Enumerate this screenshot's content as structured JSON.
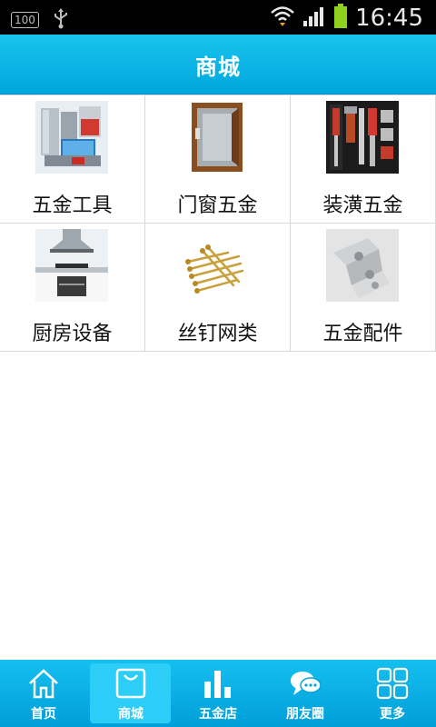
{
  "status_bar": {
    "badge": "100",
    "time": "16:45"
  },
  "header": {
    "title": "商城"
  },
  "categories": [
    {
      "label": "五金工具",
      "icon": "appliances-image"
    },
    {
      "label": "门窗五金",
      "icon": "window-image"
    },
    {
      "label": "装潢五金",
      "icon": "toolkit-image"
    },
    {
      "label": "厨房设备",
      "icon": "kitchen-image"
    },
    {
      "label": "丝钉网类",
      "icon": "nails-image"
    },
    {
      "label": "五金配件",
      "icon": "hinge-image"
    }
  ],
  "tabs": [
    {
      "label": "首页",
      "icon": "home-icon"
    },
    {
      "label": "商城",
      "icon": "shopping-bag-icon",
      "active": true
    },
    {
      "label": "五金店",
      "icon": "bar-chart-icon"
    },
    {
      "label": "朋友圈",
      "icon": "chat-icon"
    },
    {
      "label": "更多",
      "icon": "grid-icon"
    }
  ],
  "colors": {
    "accent": "#00a6dc",
    "active_tab": "#2ccdf6",
    "battery": "#8ed11f"
  }
}
